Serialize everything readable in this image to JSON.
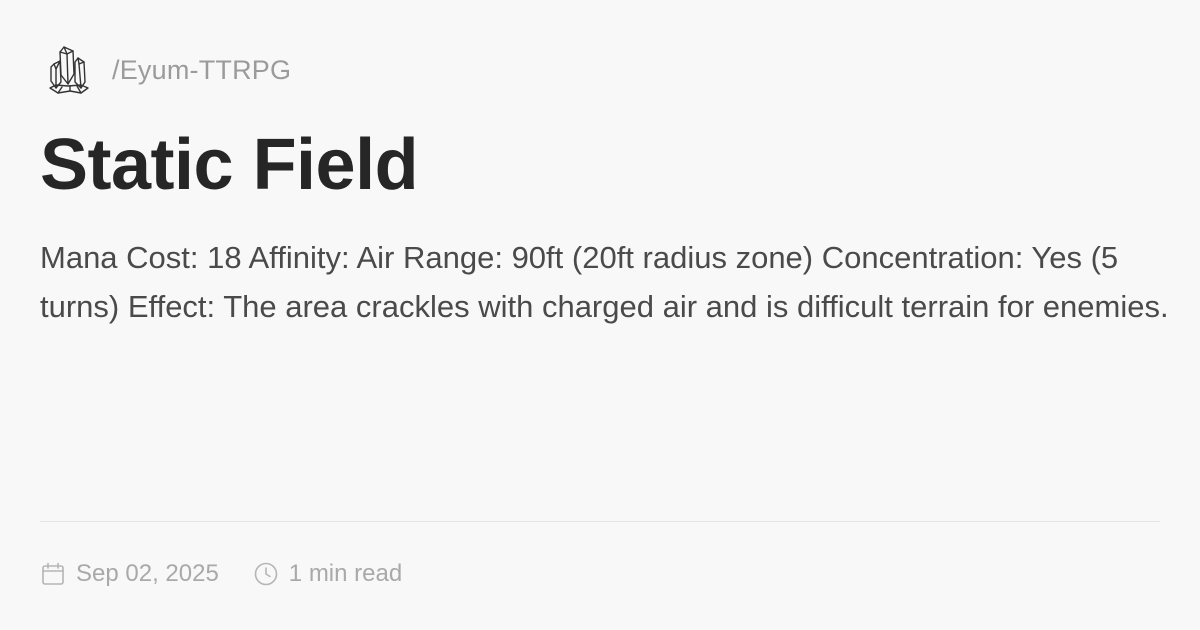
{
  "site": {
    "logo_icon": "crystal-icon",
    "path": "/Eyum-TTRPG"
  },
  "post": {
    "title": "Static Field",
    "description": "Mana Cost: 18 Affinity: Air Range: 90ft (20ft radius zone) Concentration: Yes (5 turns) Effect: The area crackles with charged air and is difficult terrain for enemies."
  },
  "meta": {
    "date_icon": "calendar-icon",
    "date": "Sep 02, 2025",
    "read_icon": "clock-icon",
    "read_time": "1 min read"
  },
  "colors": {
    "background": "#f9f8f9",
    "title": "#262626",
    "body_text": "#4a4a4a",
    "muted_text": "#9b9b9b"
  }
}
